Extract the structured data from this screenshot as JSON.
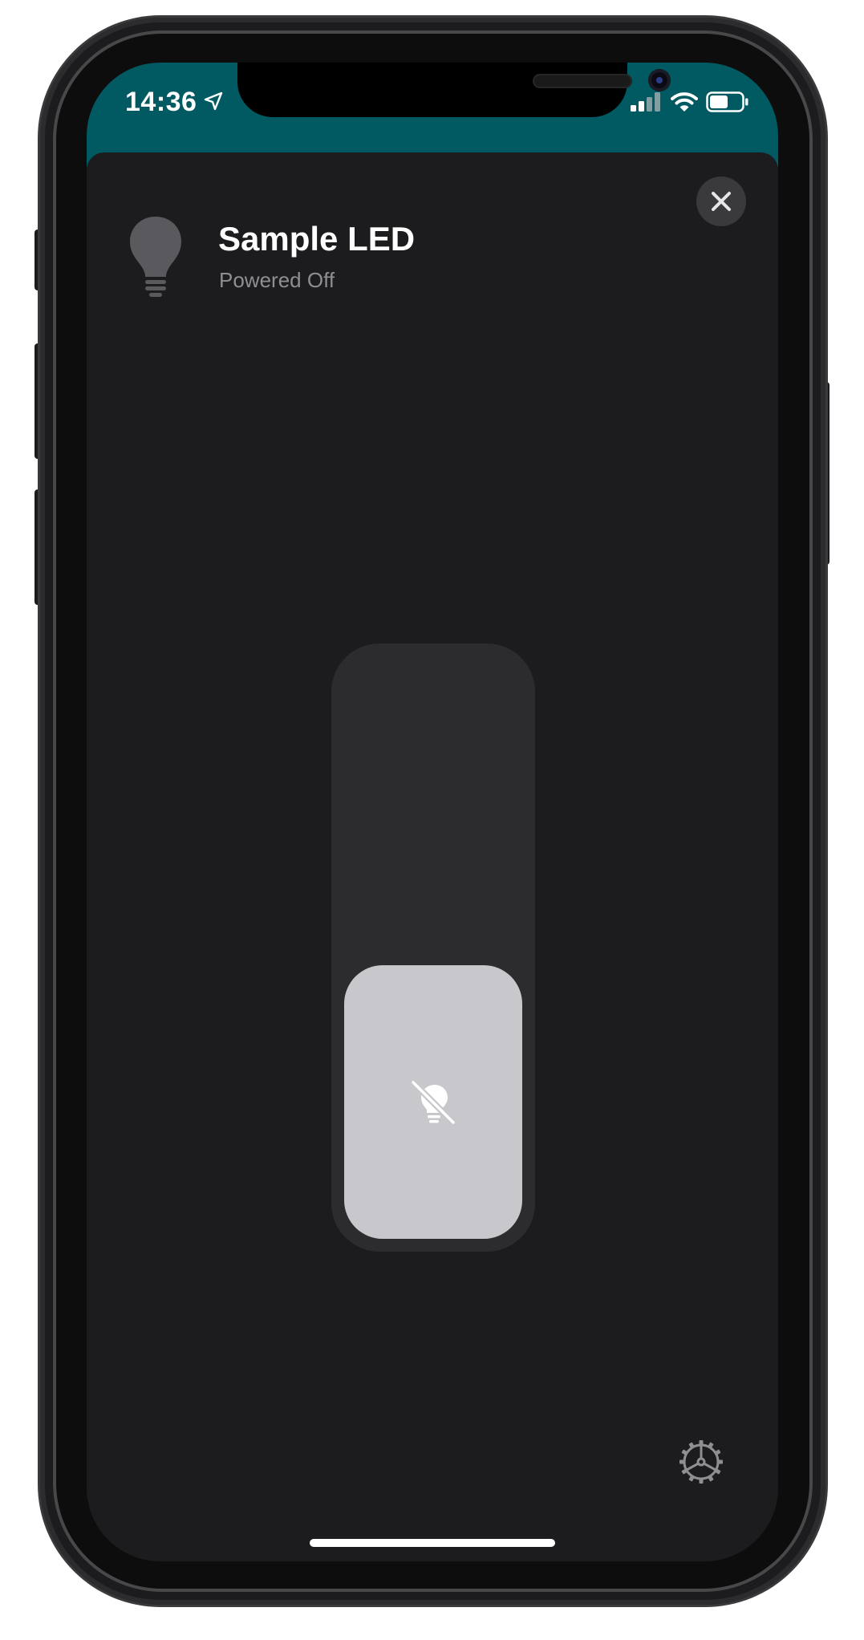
{
  "status_bar": {
    "time": "14:36",
    "icons": [
      "location-arrow-icon",
      "cellular-signal-icon",
      "wifi-icon",
      "battery-icon"
    ]
  },
  "accessory": {
    "name": "Sample LED",
    "status": "Powered Off",
    "icon": "lightbulb-icon"
  },
  "brightness_control": {
    "level_fraction": 0.47,
    "state_icon": "lightbulb-slash-icon"
  },
  "actions": {
    "close_icon": "close-icon",
    "settings_icon": "gear-icon"
  },
  "colors": {
    "status_bar_background": "#015a62",
    "sheet_background": "#1c1c1e",
    "slider_track": "#2c2c2e",
    "slider_fill": "#c7c7cc"
  }
}
